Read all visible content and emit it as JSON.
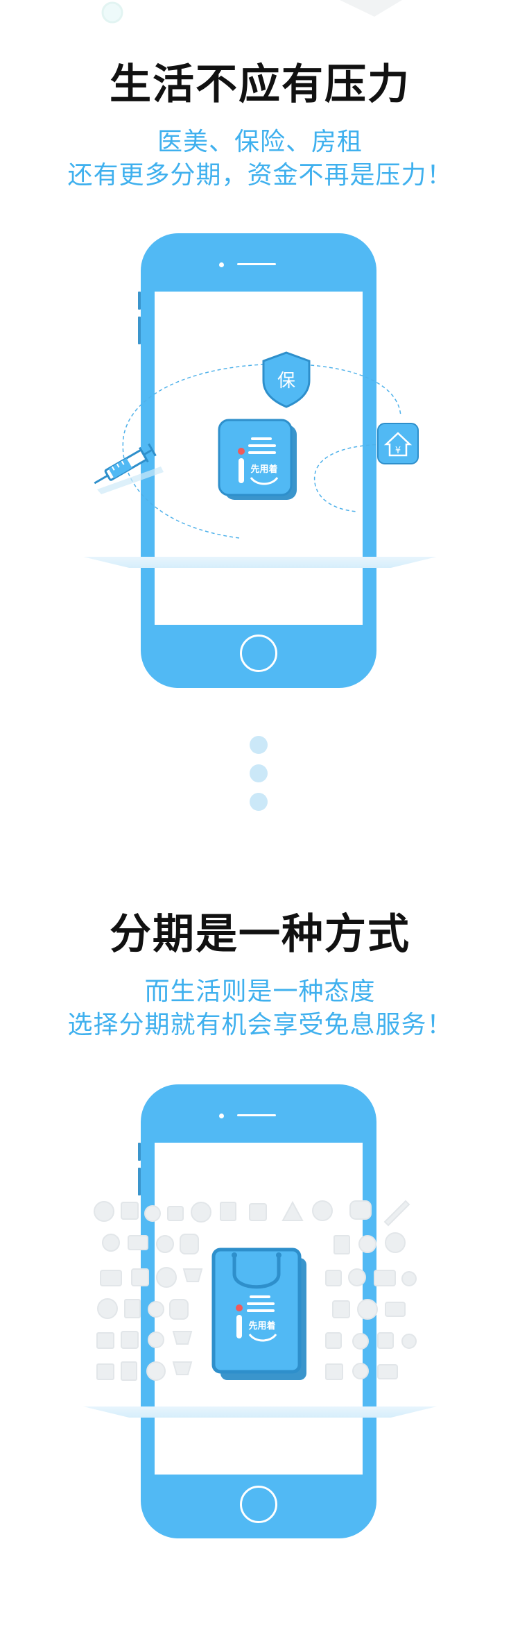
{
  "section1": {
    "headline": "生活不应有压力",
    "sub_line1": "医美、保险、房租",
    "sub_line2": "还有更多分期，资金不再是压力！",
    "shield_char": "保",
    "house_char": "¥",
    "app_logo_text": "先用着"
  },
  "section2": {
    "headline": "分期是一种方式",
    "sub_line1": "而生活则是一种态度",
    "sub_line2": "选择分期就有机会享受免息服务！",
    "app_logo_text": "先用着"
  },
  "colors": {
    "phone_blue": "#51b9f4",
    "accent_blue": "#3fb0ee",
    "dot_blue": "#cbe8f8",
    "headline": "#111111",
    "logo_red": "#f05a5a"
  },
  "icons": [
    "shield-icon",
    "house-icon",
    "syringe-icon",
    "app-logo-icon",
    "shopping-bag-icon",
    "home-button-icon"
  ]
}
